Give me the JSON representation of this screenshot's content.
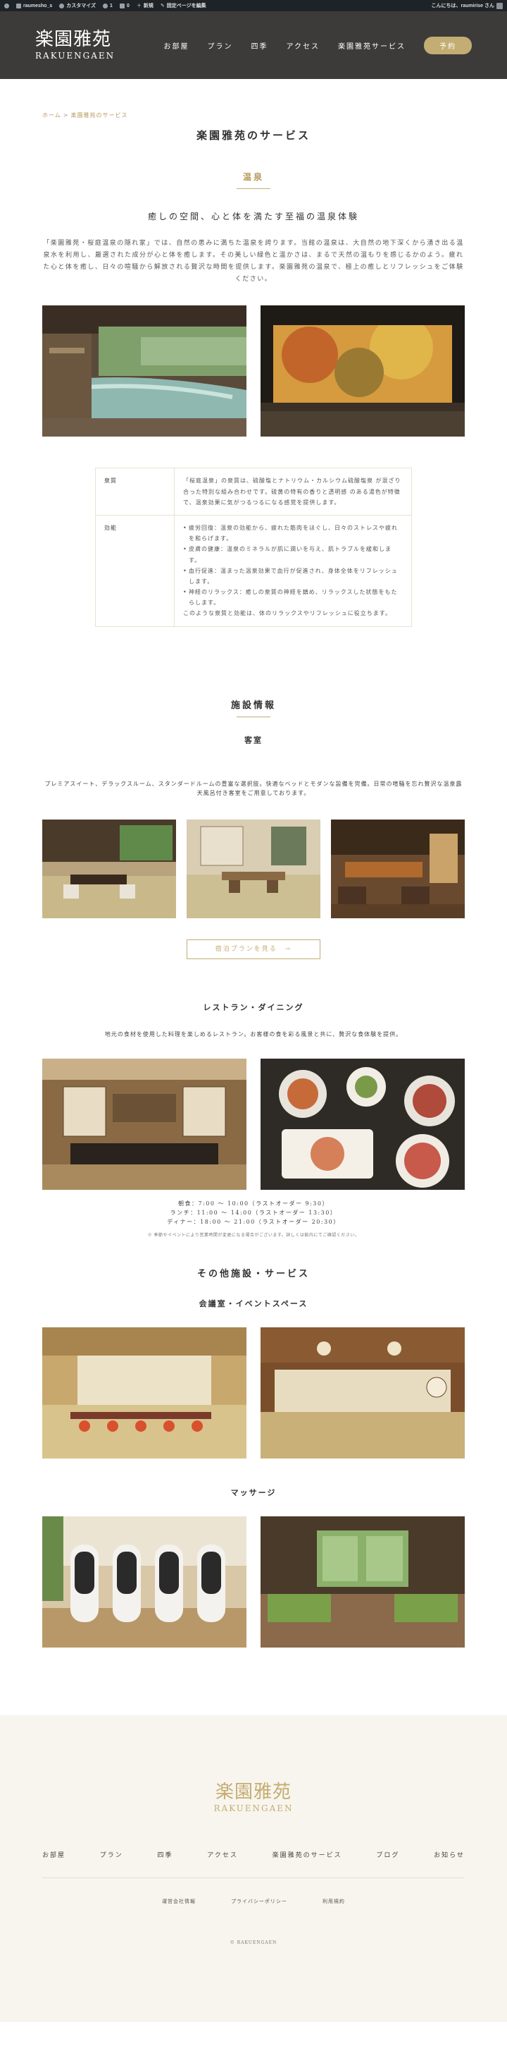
{
  "admin_bar": {
    "site": "raumesho_s",
    "customize": "カスタマイズ",
    "comments": "0",
    "updates": "1",
    "new": "新規",
    "edit": "固定ページを編集",
    "greeting": "こんにちは、raumirise さん"
  },
  "header": {
    "logo_kanji": "楽園雅苑",
    "logo_roman": "RAKUENGAEN",
    "nav": [
      "お部屋",
      "プラン",
      "四季",
      "アクセス",
      "楽園雅苑サービス"
    ],
    "reserve": "予約"
  },
  "breadcrumb": {
    "home": "ホーム",
    "sep": ">",
    "current": "楽園雅苑のサービス"
  },
  "page_title": "楽園雅苑のサービス",
  "onsen": {
    "title": "温泉",
    "tagline": "癒しの空間、心と体を満たす至福の温泉体験",
    "lead": "「楽園雅苑・桜庭温泉の隠れ家」では、自然の恵みに満ちた温泉を誇ります。当館の温泉は、大自然の地下深くから湧き出る温泉水を利用し、厳選された成分が心と体を癒します。その美しい緑色と温かさは、まるで天然の温もりを感じるかのよう。疲れた心と体を癒し、日々の喧騒から解放される贅沢な時間を提供します。楽園雅苑の温泉で、極上の癒しとリフレッシュをご体験ください。",
    "spec": [
      {
        "head": "泉質",
        "body": "「桜庭温泉」の泉質は、硫酸塩とナトリウム・カルシウム硫酸塩泉 が混ざり合った特別な組み合わせです。硫黄の特有の香りと透明感 のある湯色が特徴で、温泉効果に気がつるつるになる感覚を提供します。"
      },
      {
        "head": "効能",
        "items": [
          "疲労回復：温泉の効能から、疲れた筋肉をほぐし、日々のストレスや疲れを和らげます。",
          "皮膚の健康：温泉のミネラルが肌に潤いを与え、肌トラブルを緩和します。",
          "血行促進：温まった温泉効果で血行が促進され、身体全体をリフレッシュします。",
          "神経のリラックス：癒しの泉質の神経を鎮め、リラックスした状態をもたらします。"
        ],
        "closing": "このような泉質と効能は、体のリラックスやリフレッシュに役立ちます。"
      }
    ]
  },
  "facilities": {
    "title": "施設情報",
    "rooms": {
      "title": "客室",
      "note": "プレミアスイート、デラックスルーム、スタンダードルームの豊富な選択肢。快適なベッドとモダンな設備を完備。日常の喧騒を忘れ贅沢な温泉露天風呂付き客室をご用意しております。",
      "button": "宿泊プランを見る　→"
    },
    "restaurant": {
      "title": "レストラン・ダイニング",
      "note": "地元の食材を使用した料理を楽しめるレストラン。お客様の食を彩る風景と共に、贅沢な食体験を提供。",
      "hours": [
        "朝食：7:00 〜 10:00（ラストオーダー 9:30）",
        "ランチ：11:00 〜 14:00（ラストオーダー 13:30）",
        "ディナー：18:00 〜 21:00（ラストオーダー 20:30）"
      ],
      "small": "※ 季節やイベントにより営業時間が変更になる場合がございます。詳しくは館内にてご確認ください。"
    }
  },
  "other": {
    "title": "その他施設・サービス",
    "meeting": "会議室・イベントスペース",
    "massage": "マッサージ"
  },
  "footer": {
    "logo_kanji": "楽園雅苑",
    "logo_roman": "RAKUENGAEN",
    "nav": [
      "お部屋",
      "プラン",
      "四季",
      "アクセス",
      "楽園雅苑のサービス",
      "ブログ",
      "お知らせ"
    ],
    "sub": [
      "運営会社情報",
      "プライバシーポリシー",
      "利用規約"
    ],
    "copyright": "© RAKUENGAEN"
  },
  "colors": {
    "accent": "#c3ad72",
    "header_bg": "#3c3b3a",
    "footer_bg": "#f8f5ee"
  }
}
